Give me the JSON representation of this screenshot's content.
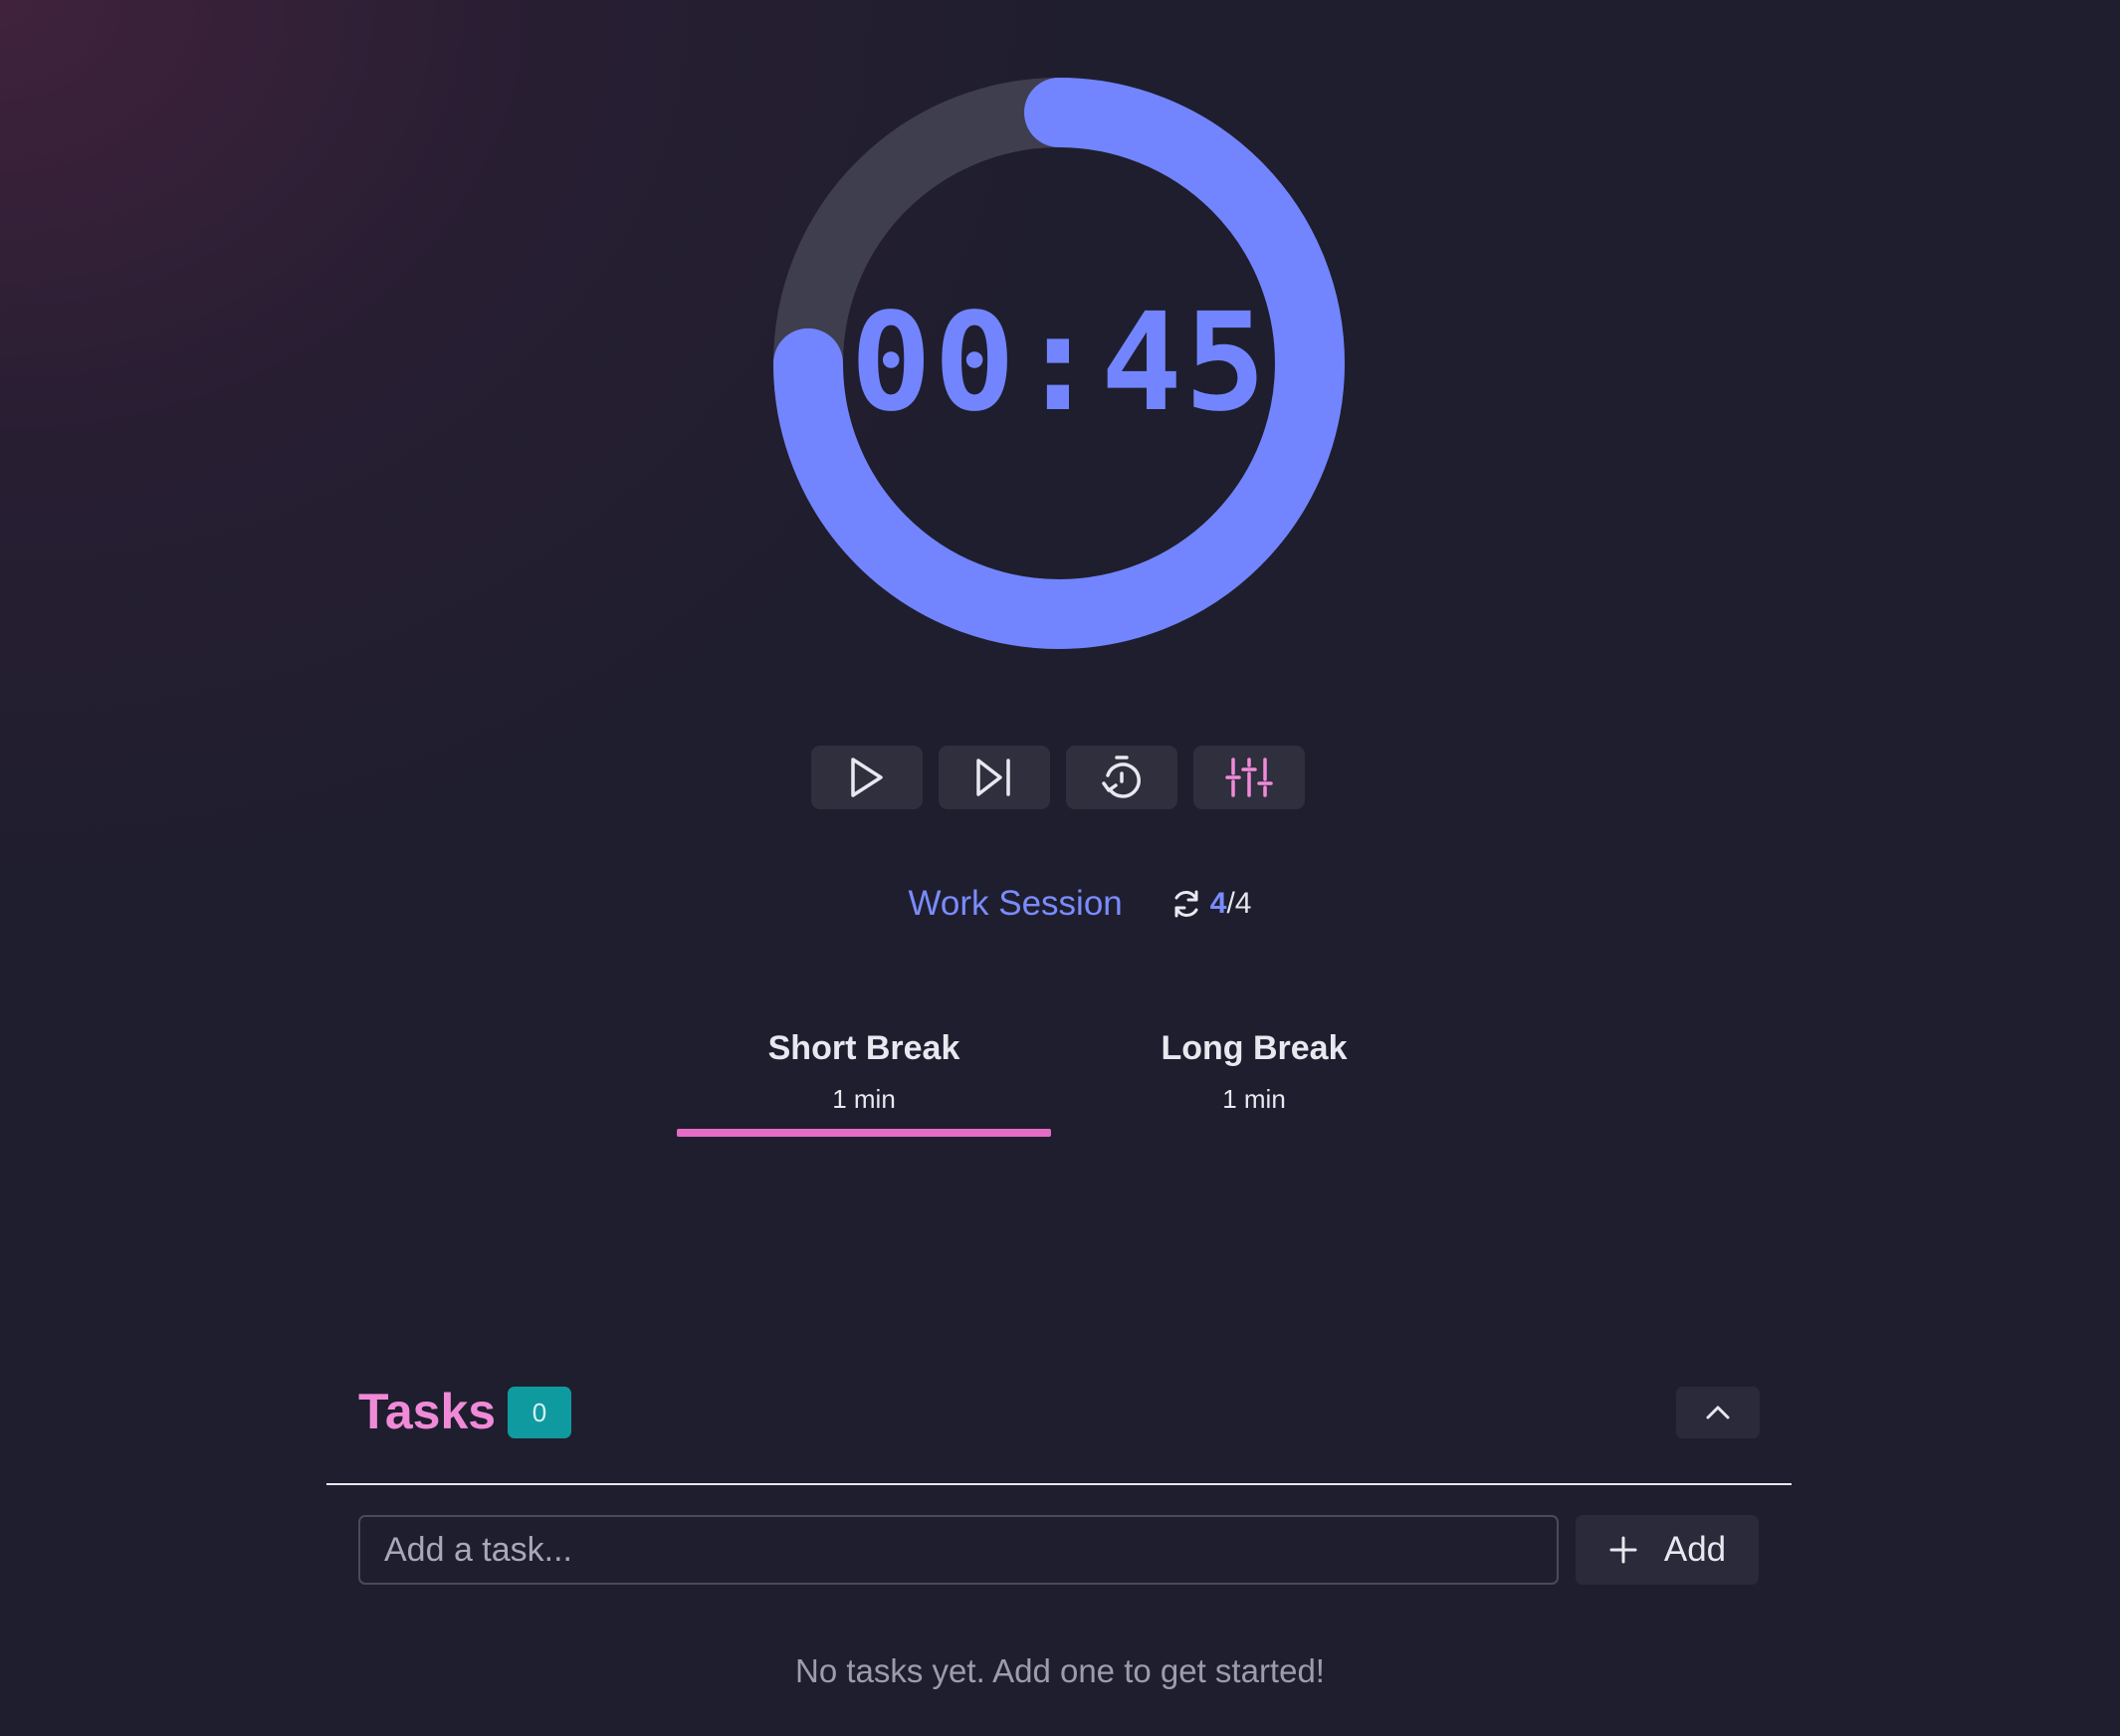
{
  "timer": {
    "display": "00:45",
    "progress_fraction": 0.75,
    "ring_color": "#7285ff",
    "track_color": "#3f3e4f"
  },
  "controls": [
    {
      "name": "play-button",
      "icon": "play-icon"
    },
    {
      "name": "skip-button",
      "icon": "skip-forward-icon"
    },
    {
      "name": "reset-timer-button",
      "icon": "timer-reset-icon"
    },
    {
      "name": "settings-button",
      "icon": "sliders-icon"
    }
  ],
  "session": {
    "label": "Work Session",
    "cycle_current": "4",
    "cycle_total": "/4"
  },
  "breaks": [
    {
      "title": "Short Break",
      "duration": "1 min",
      "active": true
    },
    {
      "title": "Long Break",
      "duration": "1 min",
      "active": false
    }
  ],
  "tasks": {
    "title": "Tasks",
    "count": "0",
    "input_placeholder": "Add a task...",
    "add_label": "Add",
    "empty_message": "No tasks yet. Add one to get started!"
  },
  "colors": {
    "background": "#1f1e2e",
    "accent_blue": "#7285ff",
    "accent_pink": "#e46cc4",
    "badge_teal": "#0f9aa0"
  }
}
